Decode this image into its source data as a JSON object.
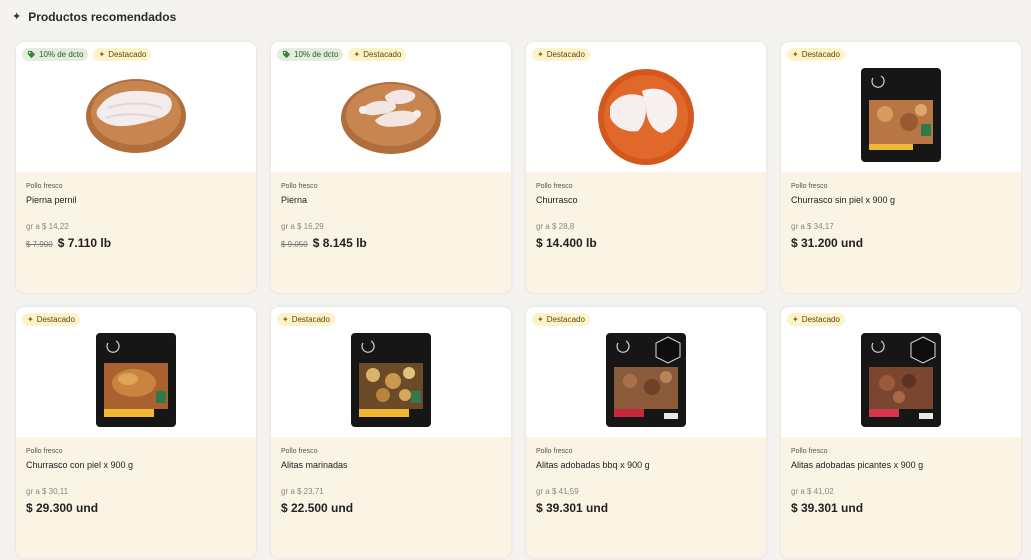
{
  "section": {
    "title": "Productos recomendados",
    "icon": "sparkle-icon"
  },
  "badges": {
    "discount_icon": "tag-icon",
    "featured_icon": "sparkle-icon"
  },
  "products": [
    {
      "discount": "10% de dcto",
      "featured": "Destacado",
      "category": "Pollo fresco",
      "name": "Pierna pernil",
      "unit_price": "gr a $ 14,22",
      "old_price": "$ 7.900",
      "price": "$ 7.110 lb",
      "image": "chicken-pernil-plate"
    },
    {
      "discount": "10% de dcto",
      "featured": "Destacado",
      "category": "Pollo fresco",
      "name": "Pierna",
      "unit_price": "gr a $ 16,29",
      "old_price": "$ 9.050",
      "price": "$ 8.145 lb",
      "image": "chicken-legs-plate"
    },
    {
      "featured": "Destacado",
      "category": "Pollo fresco",
      "name": "Churrasco",
      "unit_price": "gr a $ 28,8",
      "price": "$ 14.400 lb",
      "image": "churrasco-plate"
    },
    {
      "featured": "Destacado",
      "category": "Pollo fresco",
      "name": "Churrasco sin piel x 900 g",
      "unit_price": "gr a $ 34,17",
      "price": "$ 31.200 und",
      "image": "mac-pollo-package"
    },
    {
      "featured": "Destacado",
      "category": "Pollo fresco",
      "name": "Churrasco con piel x 900 g",
      "unit_price": "gr a $ 30,11",
      "price": "$ 29.300 und",
      "image": "mac-pollo-package"
    },
    {
      "featured": "Destacado",
      "category": "Pollo fresco",
      "name": "Alitas marinadas",
      "unit_price": "gr a $ 23,71",
      "price": "$ 22.500 und",
      "image": "mac-pollo-package"
    },
    {
      "featured": "Destacado",
      "category": "Pollo fresco",
      "name": "Alitas adobadas bbq x 900 g",
      "unit_price": "gr a $ 41,59",
      "price": "$ 39.301 und",
      "image": "mac-pollo-package"
    },
    {
      "featured": "Destacado",
      "category": "Pollo fresco",
      "name": "Alitas adobadas picantes x 900 g",
      "unit_price": "gr a $ 41,02",
      "price": "$ 39.301 und",
      "image": "mac-pollo-package"
    }
  ]
}
